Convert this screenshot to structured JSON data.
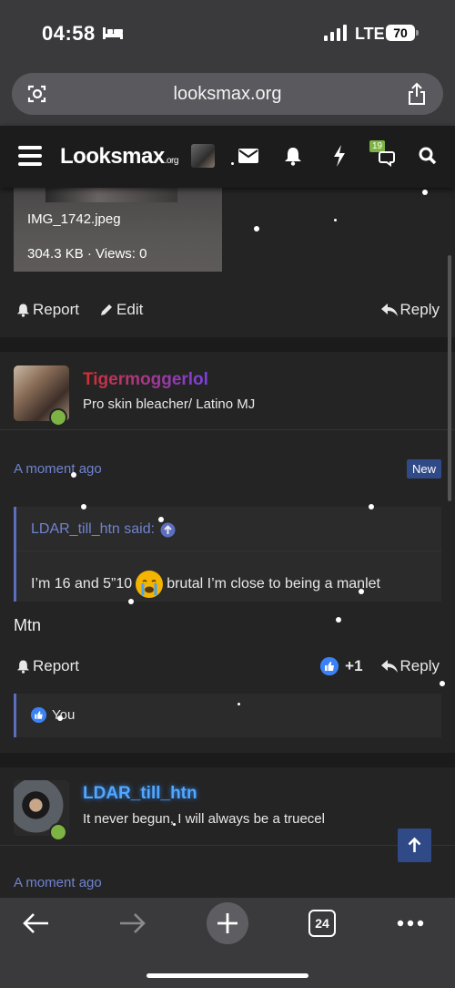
{
  "status_bar": {
    "time": "04:58",
    "network": "LTE",
    "battery": "70"
  },
  "browser": {
    "url": "looksmax.org",
    "tab_count": "24"
  },
  "site_header": {
    "logo": "Lo",
    "logo_main": "oksmax",
    "logo_suffix": ".org",
    "notification_badge": "19"
  },
  "attachment": {
    "filename": "IMG_1742.jpeg",
    "meta": "304.3 KB · Views: 0"
  },
  "post_actions": {
    "report": "Report",
    "edit": "Edit",
    "reply": "Reply",
    "reaction_count": "+1"
  },
  "post1": {
    "username": "Tigermoggerlol",
    "user_title": "Pro skin bleacher/ Latino MJ",
    "timestamp": "A moment ago",
    "new_badge": "New",
    "quote_author": "LDAR_till_htn said:",
    "quote_text_before": "I’m 16 and 5”10",
    "quote_text_after": "brutal I’m close to being a manlet",
    "body": "Mtn",
    "liked_by": "You"
  },
  "post2": {
    "username": "LDAR_till_htn",
    "user_title": "It never begun, I will always be a truecel",
    "timestamp": "A moment ago"
  },
  "colors": {
    "accent": "#6f83d0",
    "online": "#7cb342",
    "badge_bg": "#2f4a86"
  }
}
